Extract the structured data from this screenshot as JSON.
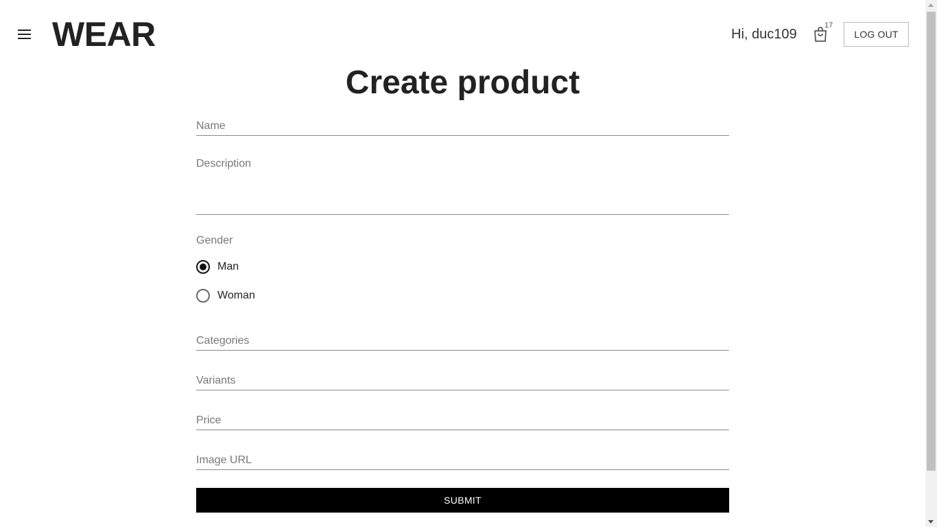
{
  "header": {
    "menu_icon": "hamburger-menu-icon",
    "logo": "WEAR",
    "greeting": "Hi, duc109",
    "cart_icon": "shopping-bag-icon",
    "cart_count": "17",
    "logout_label": "LOG OUT"
  },
  "page_title": "Create product",
  "form": {
    "name_placeholder": "Name",
    "description_placeholder": "Description",
    "gender_label": "Gender",
    "gender_options": [
      {
        "label": "Man",
        "selected": true
      },
      {
        "label": "Woman",
        "selected": false
      }
    ],
    "categories_placeholder": "Categories",
    "variants_placeholder": "Variants",
    "price_placeholder": "Price",
    "image_url_placeholder": "Image URL",
    "submit_label": "SUBMIT"
  },
  "colors": {
    "text": "#222222",
    "button_bg": "#000000",
    "button_text": "#ffffff",
    "placeholder": "#777777"
  }
}
